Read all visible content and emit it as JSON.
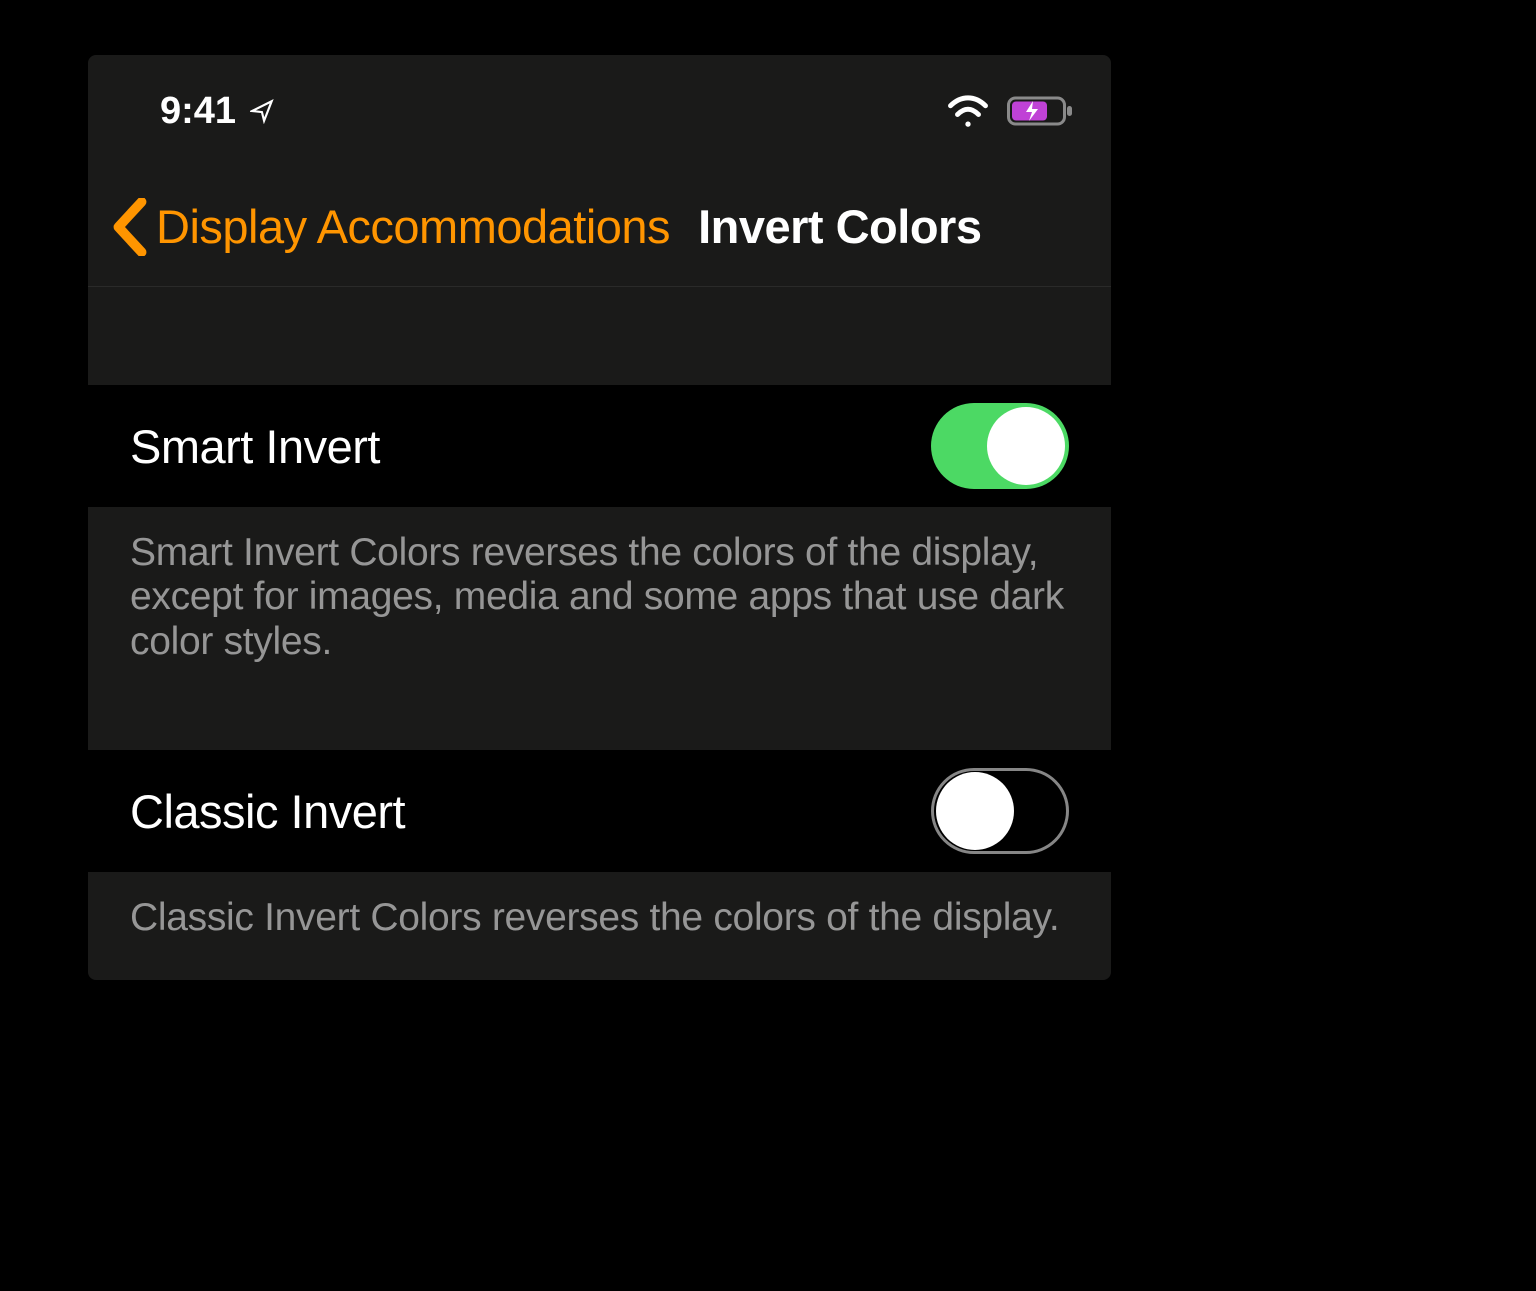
{
  "status": {
    "time": "9:41",
    "battery_color": "#c042d6"
  },
  "nav": {
    "back_label": "Display Accommodations",
    "title": "Invert Colors",
    "accent_color": "#ff9500"
  },
  "rows": [
    {
      "label": "Smart Invert",
      "enabled": true,
      "description": "Smart Invert Colors reverses the colors of the display, except for images, media and some apps that use dark color styles."
    },
    {
      "label": "Classic Invert",
      "enabled": false,
      "description": "Classic Invert Colors reverses the colors of the display."
    }
  ]
}
